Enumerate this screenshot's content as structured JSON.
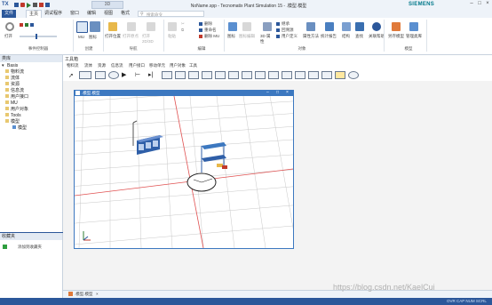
{
  "app": {
    "logo": "TX",
    "title": "NoName.spp - Tecnomatix Plant Simulation 15 - .模型.模型",
    "brand": "SIEMENS",
    "context_tab": "3D",
    "search_placeholder": "搜索命令"
  },
  "menu_tabs": [
    "文件",
    "主页",
    "调试程序",
    "窗口",
    "编辑",
    "视图",
    "格式"
  ],
  "ribbon": {
    "groups": [
      "事件控制器",
      "创建",
      "导航",
      "编辑",
      "对象",
      "模型"
    ],
    "buttons": {
      "open": "打开",
      "mu": "MU",
      "object": "图标",
      "open_location": "打开位置",
      "open_origin": "打开原点",
      "open_2d3d": "打开 2D/3D",
      "paste": "粘贴",
      "delete": "删除",
      "rename": "重命名",
      "delete_mu": "删除 MU",
      "icon": "图标",
      "icon_edit": "图标编辑",
      "d3_props": "3D 属性",
      "inherit": "继承",
      "show_attributes": "回溯源",
      "user_defined": "用户定义",
      "attributes_methods": "属性方法",
      "statistics_report": "统计报告",
      "structure": "结构",
      "find": "查找",
      "related_help": "关联帮助",
      "save_model": "另存模型",
      "manage_library": "管理类库"
    }
  },
  "left_panel": {
    "title": "类库",
    "tree": [
      "Basis",
      "物料流",
      "流体",
      "资源",
      "信息流",
      "用户接口",
      "MU",
      "用户对象",
      "Tools",
      "模型",
      "模型"
    ]
  },
  "favorites": {
    "title": "收藏夹",
    "add_label": "添加到收藏夹"
  },
  "toolbox": {
    "title": "工具箱",
    "tabs": [
      "物料流",
      "流体",
      "资源",
      "信息流",
      "用户接口",
      "移动单元",
      "用户对象",
      "工具"
    ]
  },
  "model_window": {
    "title": ".模型.模型"
  },
  "bottom_tab": ".模型.模型",
  "status": {
    "right": "OVR CAP NUM SCRL",
    "watermark": "https://blog.csdn.net/KaelCui"
  },
  "colors": {
    "accent": "#2b579a",
    "window_border": "#3c78c0",
    "grid_red": "#e05050"
  }
}
